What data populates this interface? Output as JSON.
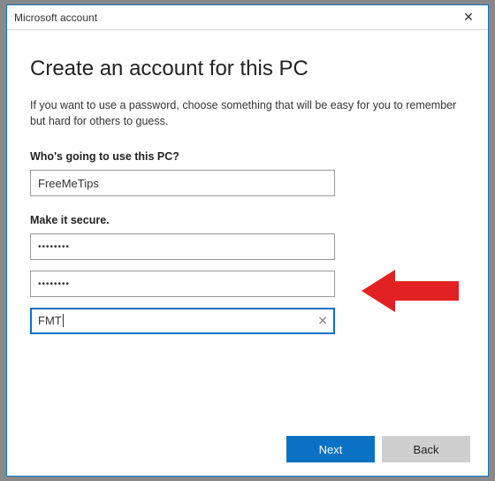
{
  "window": {
    "title": "Microsoft account"
  },
  "page": {
    "heading": "Create an account for this PC",
    "description": "If you want to use a password, choose something that will be easy for you to remember but hard for others to guess."
  },
  "sections": {
    "user_label": "Who's going to use this PC?",
    "secure_label": "Make it secure."
  },
  "fields": {
    "username": "FreeMeTips",
    "password": "••••••••",
    "password_confirm": "••••••••",
    "hint": "FMT"
  },
  "buttons": {
    "next": "Next",
    "back": "Back"
  },
  "annotation": {
    "arrow_color": "#e22222"
  }
}
